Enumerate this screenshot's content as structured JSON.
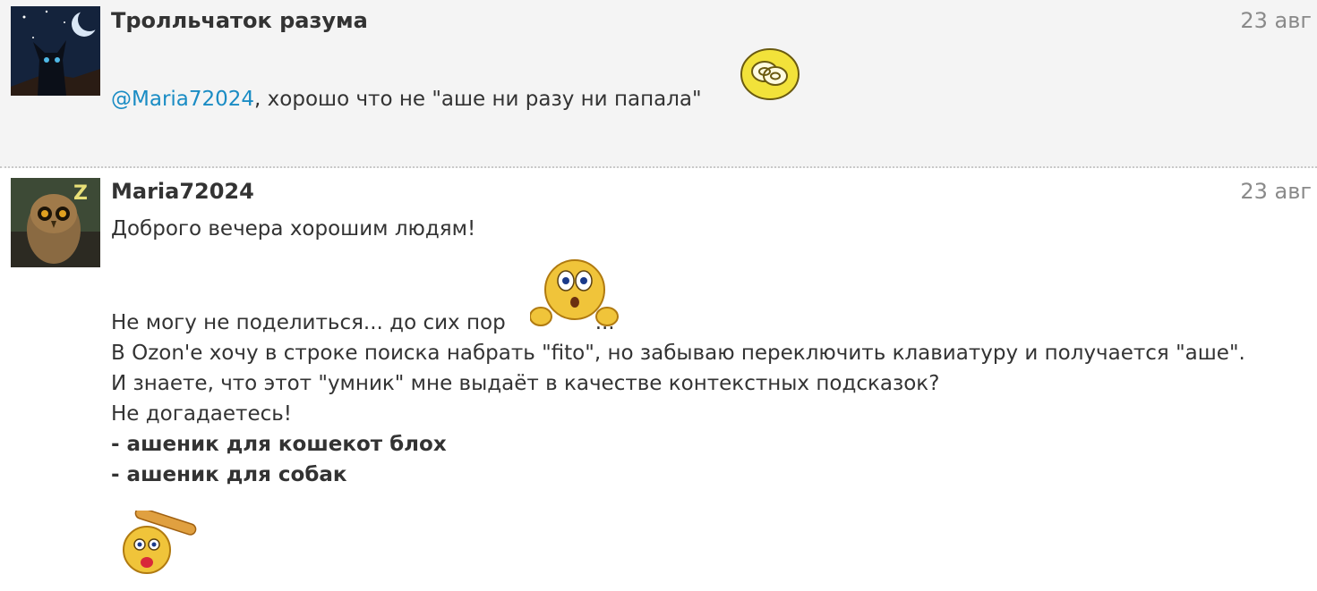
{
  "posts": [
    {
      "author": "Тролльчаток разума",
      "date": "23 авг",
      "mention": "@Maria72024",
      "text": ", хорошо что не \"аше ни разу ни папала\"",
      "avatar_icon": "night-cat-avatar-icon",
      "smiley_icon": "dizzy-smiley-icon"
    },
    {
      "author": "Maria72024",
      "date": "23 авг",
      "avatar_icon": "owl-avatar-icon",
      "lines": {
        "greeting": "Доброго вечера хорошим людям!",
        "line1_start": "Не могу не поделиться... до сих пор",
        "line1_end": "...",
        "line2": "В Ozon'е хочу в строке поиска набрать \"fito\", но забываю переключить клавиатуру и получается \"аше\".",
        "line3": "И знаете, что этот \"умник\" мне выдаёт в качестве контекстных подсказок?",
        "line4": "Не догадаетесь!",
        "bold1": "- ашеник для кошекот блох",
        "bold2": "- ашеник для собак"
      },
      "smiley_icons": [
        "shocked-peeking-smiley-icon",
        "bonk-smiley-icon"
      ]
    }
  ],
  "colors": {
    "post1_bg": "#f4f4f4",
    "mention": "#1a8cc4",
    "date": "#8a8a8a",
    "separator": "#c9c9c9"
  }
}
